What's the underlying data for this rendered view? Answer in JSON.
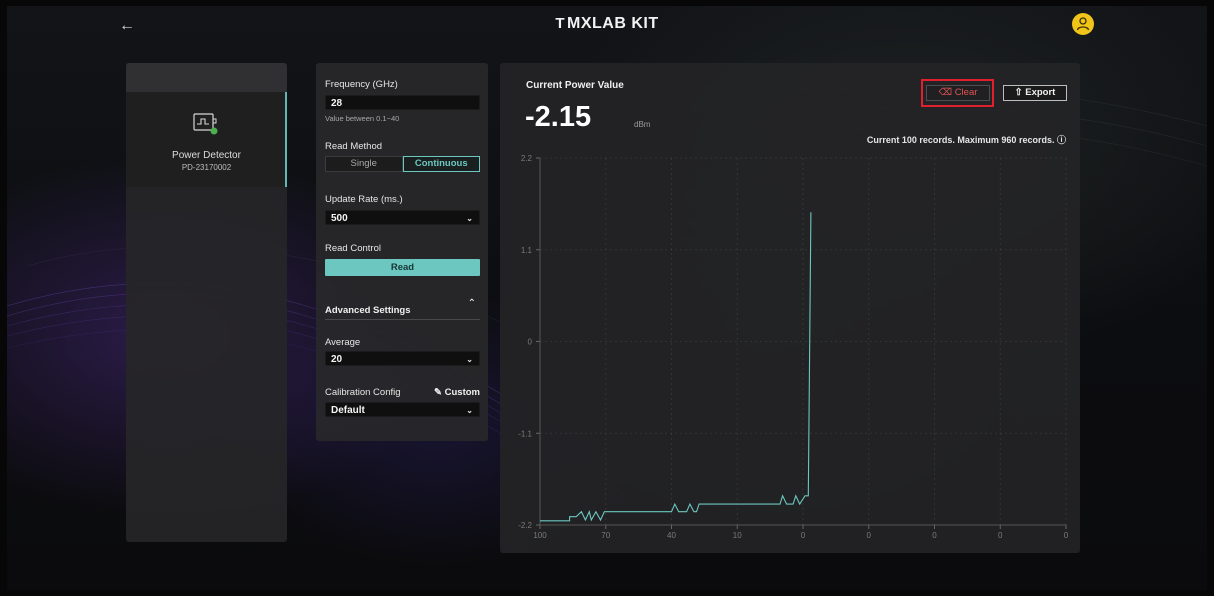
{
  "header": {
    "back_icon": "arrow-left-icon",
    "brand": "MXLAB KIT",
    "brand_mark": "T",
    "avatar_icon": "user-icon",
    "avatar_color": "#f0c419"
  },
  "device": {
    "name": "Power Detector",
    "id": "PD-23170002",
    "icon": "power-detector-icon",
    "status_color": "#4caf50"
  },
  "settings": {
    "frequency": {
      "label": "Frequency (GHz)",
      "value": "28",
      "hint": "Value between 0.1~40"
    },
    "read_method": {
      "label": "Read Method",
      "options": [
        "Single",
        "Continuous"
      ],
      "selected": "Continuous"
    },
    "update_rate": {
      "label": "Update Rate (ms.)",
      "value": "500"
    },
    "read_control": {
      "label": "Read Control",
      "button": "Read"
    },
    "advanced": {
      "label": "Advanced Settings",
      "expanded": true
    },
    "average": {
      "label": "Average",
      "value": "20"
    },
    "calibration": {
      "label": "Calibration Config",
      "custom": "Custom",
      "value": "Default"
    }
  },
  "panel": {
    "title": "Current Power Value",
    "value": "-2.15",
    "unit": "dBm",
    "clear": "Clear",
    "export": "Export",
    "records": "Current 100 records. Maximum 960 records."
  },
  "colors": {
    "accent": "#6cc7c0",
    "danger": "#e25454",
    "highlight": "#e21f2f"
  },
  "chart_data": {
    "type": "line",
    "xlabel": "",
    "ylabel": "",
    "x_ticks": [
      "100",
      "70",
      "40",
      "10",
      "0",
      "0",
      "0",
      "0",
      "0"
    ],
    "y_ticks": [
      2.2,
      1.1,
      0,
      -1.1,
      -2.2
    ],
    "y_tick_labels": [
      "2.2",
      "1.1",
      "0",
      "-1.1",
      "-2.2"
    ],
    "ylim": [
      -2.2,
      2.2
    ],
    "grid": true,
    "series": [
      {
        "color": "#6cc7c0",
        "points": [
          [
            0,
            -2.15
          ],
          [
            4.5,
            -2.15
          ],
          [
            4.5,
            -2.1
          ],
          [
            5.5,
            -2.1
          ],
          [
            6.3,
            -2.04
          ],
          [
            6.9,
            -2.14
          ],
          [
            7.5,
            -2.04
          ],
          [
            7.8,
            -2.14
          ],
          [
            8.5,
            -2.04
          ],
          [
            9.2,
            -2.14
          ],
          [
            9.8,
            -2.04
          ],
          [
            20,
            -2.04
          ],
          [
            20.5,
            -1.95
          ],
          [
            21.1,
            -2.04
          ],
          [
            22.3,
            -2.04
          ],
          [
            22.8,
            -1.95
          ],
          [
            23.4,
            -2.04
          ],
          [
            23.8,
            -2.04
          ],
          [
            24.2,
            -1.95
          ],
          [
            36.5,
            -1.95
          ],
          [
            36.9,
            -1.85
          ],
          [
            37.5,
            -1.95
          ],
          [
            38.5,
            -1.95
          ],
          [
            38.9,
            -1.85
          ],
          [
            39.5,
            -1.95
          ],
          [
            40.3,
            -1.85
          ],
          [
            40.8,
            -1.85
          ],
          [
            41.2,
            1.55
          ]
        ]
      }
    ]
  }
}
